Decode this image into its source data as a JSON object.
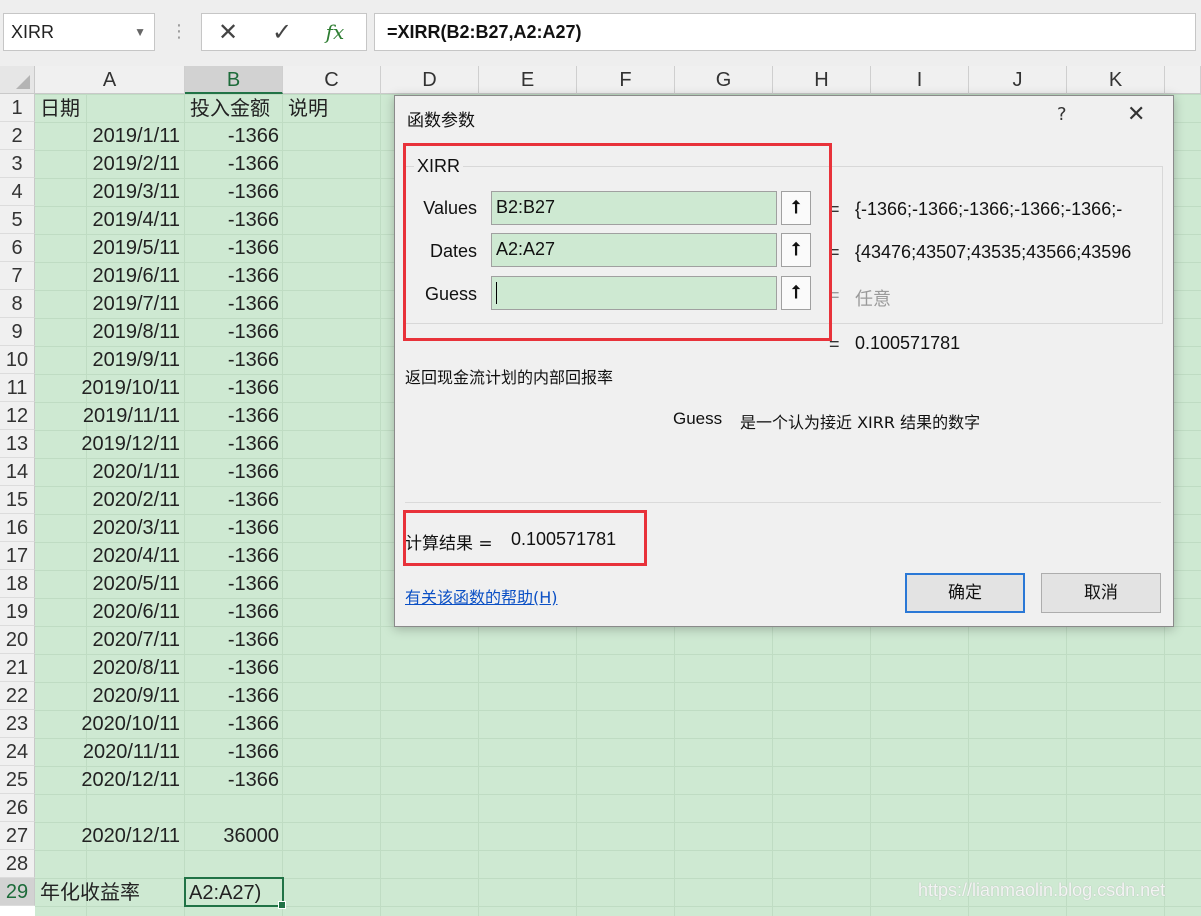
{
  "formula_bar": {
    "name_box": "XIRR",
    "cancel_icon": "✕",
    "enter_icon": "✓",
    "fx_label": "fx",
    "formula": "=XIRR(B2:B27,A2:A27)"
  },
  "columns": [
    "A",
    "B",
    "C",
    "D",
    "E",
    "F",
    "G",
    "H",
    "I",
    "J",
    "K"
  ],
  "rows": [
    "1",
    "2",
    "3",
    "4",
    "5",
    "6",
    "7",
    "8",
    "9",
    "10",
    "11",
    "12",
    "13",
    "14",
    "15",
    "16",
    "17",
    "18",
    "19",
    "20",
    "21",
    "22",
    "23",
    "24",
    "25",
    "26",
    "27",
    "28",
    "29"
  ],
  "sheet": {
    "header_a": "日期",
    "header_b": "投入金额",
    "header_c": "说明",
    "dates": [
      "2019/1/11",
      "2019/2/11",
      "2019/3/11",
      "2019/4/11",
      "2019/5/11",
      "2019/6/11",
      "2019/7/11",
      "2019/8/11",
      "2019/9/11",
      "2019/10/11",
      "2019/11/11",
      "2019/12/11",
      "2020/1/11",
      "2020/2/11",
      "2020/3/11",
      "2020/4/11",
      "2020/5/11",
      "2020/6/11",
      "2020/7/11",
      "2020/8/11",
      "2020/9/11",
      "2020/10/11",
      "2020/11/11",
      "2020/12/11"
    ],
    "amounts": [
      "-1366",
      "-1366",
      "-1366",
      "-1366",
      "-1366",
      "-1366",
      "-1366",
      "-1366",
      "-1366",
      "-1366",
      "-1366",
      "-1366",
      "-1366",
      "-1366",
      "-1366",
      "-1366",
      "-1366",
      "-1366",
      "-1366",
      "-1366",
      "-1366",
      "-1366",
      "-1366",
      "-1366"
    ],
    "row27_date": "2020/12/11",
    "row27_amount": "36000",
    "row29_label": "年化收益率",
    "row29_value": "A2:A27)"
  },
  "watermark": "https://lianmaolin.blog.csdn.net",
  "dialog": {
    "title": "函数参数",
    "help_icon": "?",
    "close_icon": "✕",
    "function_name": "XIRR",
    "args": [
      {
        "label": "Values",
        "value": "B2:B27",
        "result": "{-1366;-1366;-1366;-1366;-1366;-"
      },
      {
        "label": "Dates",
        "value": "A2:A27",
        "result": "{43476;43507;43535;43566;43596"
      },
      {
        "label": "Guess",
        "value": "",
        "result": "任意"
      }
    ],
    "overall_result": "0.100571781",
    "description": "返回现金流计划的内部回报率",
    "param_name": "Guess",
    "param_desc": "是一个认为接近 XIRR 结果的数字",
    "calc_label": "计算结果 =",
    "calc_value": "0.100571781",
    "help_link": "有关该函数的帮助(H)",
    "ok_label": "确定",
    "cancel_label": "取消"
  }
}
